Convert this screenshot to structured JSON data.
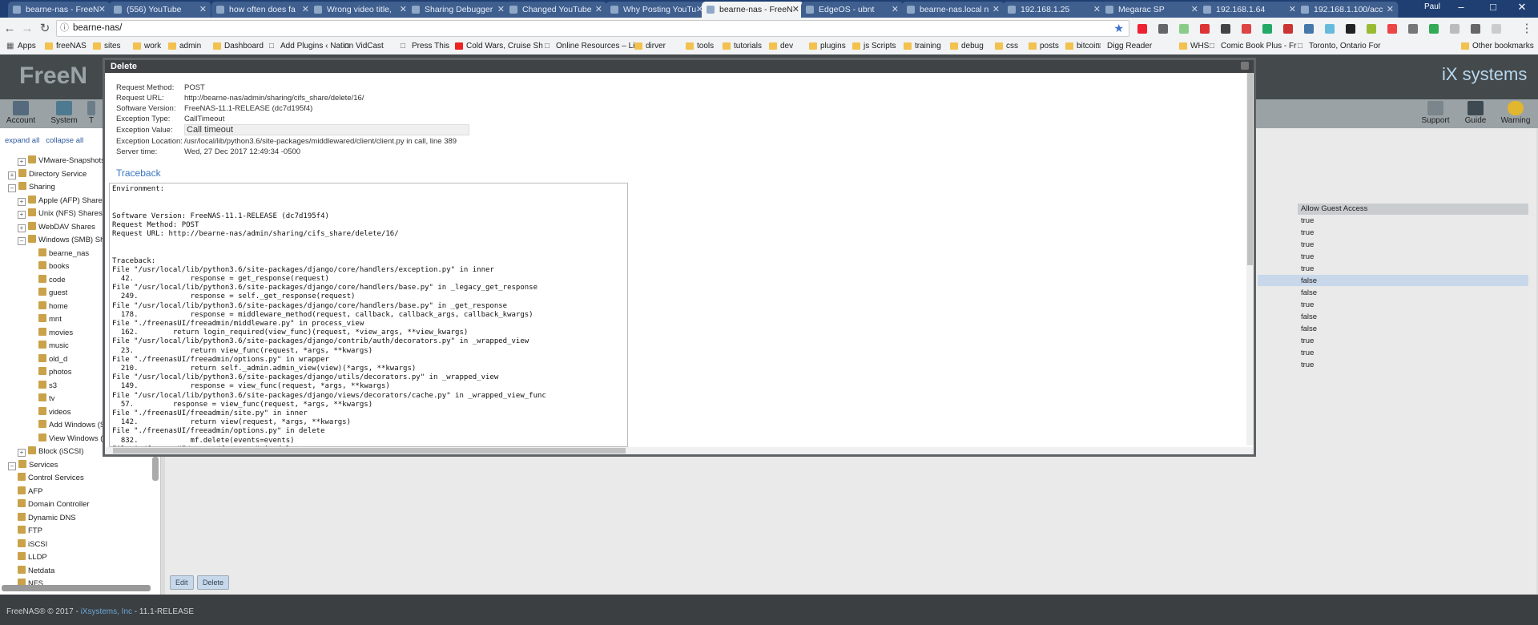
{
  "browser": {
    "tabs": [
      {
        "label": "bearne-nas - FreeN",
        "active": false
      },
      {
        "label": "(556) YouTube",
        "active": false
      },
      {
        "label": "how often does fa",
        "active": false
      },
      {
        "label": "Wrong video title, ",
        "active": false
      },
      {
        "label": "Sharing Debugger",
        "active": false
      },
      {
        "label": "Changed YouTube ",
        "active": false
      },
      {
        "label": "Why Posting YouTu",
        "active": false
      },
      {
        "label": "bearne-nas - FreeN",
        "active": true
      },
      {
        "label": "EdgeOS - ubnt",
        "active": false
      },
      {
        "label": "bearne-nas.local n",
        "active": false
      },
      {
        "label": "192.168.1.25",
        "active": false
      },
      {
        "label": "Megarac SP",
        "active": false
      },
      {
        "label": "192.168.1.64",
        "active": false
      },
      {
        "label": "192.168.1.100/acc",
        "active": false
      }
    ],
    "profile_name": "Paul",
    "address": "bearne-nas/",
    "bookmarks": [
      {
        "label": "Apps",
        "type": "apps"
      },
      {
        "label": "freeNAS",
        "type": "folder"
      },
      {
        "label": "sites",
        "type": "folder"
      },
      {
        "label": "work",
        "type": "folder"
      },
      {
        "label": "admin",
        "type": "folder"
      },
      {
        "label": "Dashboard",
        "type": "folder"
      },
      {
        "label": "Add Plugins ‹ Nation",
        "type": "page"
      },
      {
        "label": "VidCast",
        "type": "page"
      },
      {
        "label": "Press This",
        "type": "page"
      },
      {
        "label": "Cold Wars, Cruise Sh",
        "type": "youtube"
      },
      {
        "label": "Online Resources – Li",
        "type": "page"
      },
      {
        "label": "dirver",
        "type": "folder"
      },
      {
        "label": "tools",
        "type": "folder"
      },
      {
        "label": "tutorials",
        "type": "folder"
      },
      {
        "label": "dev",
        "type": "folder"
      },
      {
        "label": "plugins",
        "type": "folder"
      },
      {
        "label": "js Scripts",
        "type": "folder"
      },
      {
        "label": "training",
        "type": "folder"
      },
      {
        "label": "debug",
        "type": "folder"
      },
      {
        "label": "css",
        "type": "folder"
      },
      {
        "label": "posts",
        "type": "folder"
      },
      {
        "label": "bitcoin",
        "type": "folder"
      },
      {
        "label": "Digg Reader",
        "type": "page"
      },
      {
        "label": "WHS",
        "type": "folder"
      },
      {
        "label": "Comic Book Plus - Fr",
        "type": "page"
      },
      {
        "label": "Toronto, Ontario For",
        "type": "page"
      },
      {
        "label": "Other bookmarks",
        "type": "folder"
      }
    ]
  },
  "app": {
    "brand": "FreeN",
    "vendor": "iX systems",
    "toolbar_left": [
      "Account",
      "System",
      "T"
    ],
    "toolbar_right": [
      "Support",
      "Guide",
      "Warning"
    ],
    "tree_expand_all": "expand all",
    "tree_collapse_all": "collapse all",
    "tree": [
      {
        "label": "VMware-Snapshots",
        "level": 2
      },
      {
        "label": "Directory Service",
        "level": 1
      },
      {
        "label": "Sharing",
        "level": 1
      },
      {
        "label": "Apple (AFP) Shares",
        "level": 2
      },
      {
        "label": "Unix (NFS) Shares",
        "level": 2
      },
      {
        "label": "WebDAV Shares",
        "level": 2
      },
      {
        "label": "Windows (SMB) Sh",
        "level": 2
      },
      {
        "label": "bearne_nas",
        "level": 3
      },
      {
        "label": "books",
        "level": 3
      },
      {
        "label": "code",
        "level": 3
      },
      {
        "label": "guest",
        "level": 3
      },
      {
        "label": "home",
        "level": 3
      },
      {
        "label": "mnt",
        "level": 3
      },
      {
        "label": "movies",
        "level": 3
      },
      {
        "label": "music",
        "level": 3
      },
      {
        "label": "old_d",
        "level": 3
      },
      {
        "label": "photos",
        "level": 3
      },
      {
        "label": "s3",
        "level": 3
      },
      {
        "label": "tv",
        "level": 3
      },
      {
        "label": "videos",
        "level": 3
      },
      {
        "label": "Add Windows (S",
        "level": 3
      },
      {
        "label": "View Windows (",
        "level": 3
      },
      {
        "label": "Block (iSCSI)",
        "level": 2
      },
      {
        "label": "Services",
        "level": 1
      },
      {
        "label": "Control Services",
        "level": 2
      },
      {
        "label": "AFP",
        "level": 2
      },
      {
        "label": "Domain Controller",
        "level": 2
      },
      {
        "label": "Dynamic DNS",
        "level": 2
      },
      {
        "label": "FTP",
        "level": 2
      },
      {
        "label": "iSCSI",
        "level": 2
      },
      {
        "label": "LLDP",
        "level": 2
      },
      {
        "label": "Netdata",
        "level": 2
      },
      {
        "label": "NFS",
        "level": 2
      }
    ],
    "grid_header": "Allow Guest Access",
    "grid_values": [
      "true",
      "true",
      "true",
      "true",
      "true",
      "false",
      "false",
      "true",
      "false",
      "false",
      "true",
      "true",
      "true"
    ],
    "edit_button": "Edit",
    "delete_button": "Delete",
    "footer_prefix": "FreeNAS® © 2017 - ",
    "footer_link": "iXsystems, Inc",
    "footer_suffix": " - 11.1-RELEASE"
  },
  "modal": {
    "title": "Delete",
    "request_method_label": "Request Method:",
    "request_method": "POST",
    "request_url_label": "Request URL:",
    "request_url": "http://bearne-nas/admin/sharing/cifs_share/delete/16/",
    "software_version_label": "Software Version:",
    "software_version": "FreeNAS-11.1-RELEASE (dc7d195f4)",
    "exception_type_label": "Exception Type:",
    "exception_type": "CallTimeout",
    "exception_value_label": "Exception Value:",
    "exception_value": "Call timeout",
    "exception_location_label": "Exception Location:",
    "exception_location": "/usr/local/lib/python3.6/site-packages/middlewared/client/client.py in call, line 389",
    "server_time_label": "Server time:",
    "server_time": "Wed, 27 Dec 2017 12:49:34 -0500",
    "traceback_heading": "Traceback",
    "traceback_text": "Environment:\n\n\nSoftware Version: FreeNAS-11.1-RELEASE (dc7d195f4)\nRequest Method: POST\nRequest URL: http://bearne-nas/admin/sharing/cifs_share/delete/16/\n\n\nTraceback:\nFile \"/usr/local/lib/python3.6/site-packages/django/core/handlers/exception.py\" in inner\n  42.             response = get_response(request)\nFile \"/usr/local/lib/python3.6/site-packages/django/core/handlers/base.py\" in _legacy_get_response\n  249.            response = self._get_response(request)\nFile \"/usr/local/lib/python3.6/site-packages/django/core/handlers/base.py\" in _get_response\n  178.            response = middleware_method(request, callback, callback_args, callback_kwargs)\nFile \"./freenasUI/freeadmin/middleware.py\" in process_view\n  162.        return login_required(view_func)(request, *view_args, **view_kwargs)\nFile \"/usr/local/lib/python3.6/site-packages/django/contrib/auth/decorators.py\" in _wrapped_view\n  23.             return view_func(request, *args, **kwargs)\nFile \"./freenasUI/freeadmin/options.py\" in wrapper\n  210.            return self._admin.admin_view(view)(*args, **kwargs)\nFile \"/usr/local/lib/python3.6/site-packages/django/utils/decorators.py\" in _wrapped_view\n  149.            response = view_func(request, *args, **kwargs)\nFile \"/usr/local/lib/python3.6/site-packages/django/views/decorators/cache.py\" in _wrapped_view_func\n  57.         response = view_func(request, *args, **kwargs)\nFile \"./freenasUI/freeadmin/site.py\" in inner\n  142.            return view(request, *args, **kwargs)\nFile \"./freenasUI/freeadmin/options.py\" in delete\n  832.            mf.delete(events=events)\nFile \"./freenasUI/common/forms.py\" in delete"
  },
  "colors": {
    "tabbar": "#1f3f73",
    "app_header": "#44494c",
    "modal_title": "#3f4346",
    "link": "#3875c1"
  }
}
